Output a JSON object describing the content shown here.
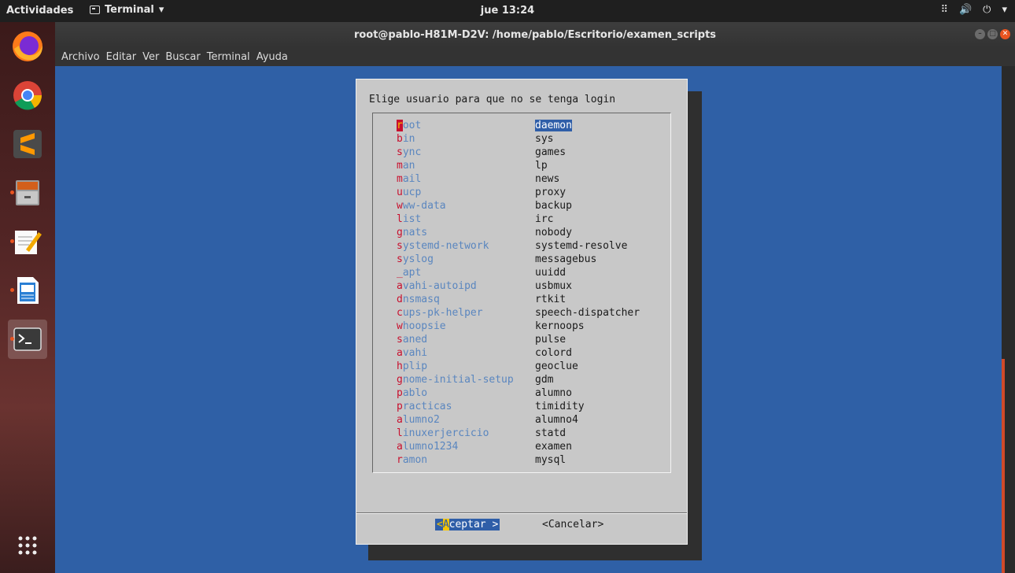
{
  "topbar": {
    "activities": "Actividades",
    "app_menu": "Terminal",
    "clock": "jue 13:24"
  },
  "window": {
    "title": "root@pablo-H81M-D2V: /home/pablo/Escritorio/examen_scripts",
    "menu": [
      "Archivo",
      "Editar",
      "Ver",
      "Buscar",
      "Terminal",
      "Ayuda"
    ]
  },
  "dock": {
    "items": [
      "firefox-icon",
      "chrome-icon",
      "sublime-text-icon",
      "files-icon",
      "text-editor-icon",
      "libreoffice-writer-icon",
      "terminal-icon",
      "show-apps-icon"
    ]
  },
  "dialog": {
    "prompt": "Elige usuario para que no se tenga login",
    "rows": [
      {
        "tag": "root",
        "item": "daemon",
        "selected": true
      },
      {
        "tag": "bin",
        "item": "sys"
      },
      {
        "tag": "sync",
        "item": "games"
      },
      {
        "tag": "man",
        "item": "lp"
      },
      {
        "tag": "mail",
        "item": "news"
      },
      {
        "tag": "uucp",
        "item": "proxy"
      },
      {
        "tag": "www-data",
        "item": "backup"
      },
      {
        "tag": "list",
        "item": "irc"
      },
      {
        "tag": "gnats",
        "item": "nobody"
      },
      {
        "tag": "systemd-network",
        "item": "systemd-resolve"
      },
      {
        "tag": "syslog",
        "item": "messagebus"
      },
      {
        "tag": "_apt",
        "item": "uuidd"
      },
      {
        "tag": "avahi-autoipd",
        "item": "usbmux"
      },
      {
        "tag": "dnsmasq",
        "item": "rtkit"
      },
      {
        "tag": "cups-pk-helper",
        "item": "speech-dispatcher"
      },
      {
        "tag": "whoopsie",
        "item": "kernoops"
      },
      {
        "tag": "saned",
        "item": "pulse"
      },
      {
        "tag": "avahi",
        "item": "colord"
      },
      {
        "tag": "hplip",
        "item": "geoclue"
      },
      {
        "tag": "gnome-initial-setup",
        "item": "gdm"
      },
      {
        "tag": "pablo",
        "item": "alumno"
      },
      {
        "tag": "practicas",
        "item": "timidity"
      },
      {
        "tag": "alumno2",
        "item": "alumno4"
      },
      {
        "tag": "linuxerjercicio",
        "item": "statd"
      },
      {
        "tag": "alumno1234",
        "item": "examen"
      },
      {
        "tag": "ramon",
        "item": "mysql"
      }
    ],
    "ok_button": {
      "open": "<",
      "hotkey": "A",
      "rest": "ceptar >"
    },
    "cancel_button": "<Cancelar>"
  },
  "colors": {
    "screen_bg": "#2f60a6",
    "dialog_bg": "#c8c8c8",
    "tag_first_letter": "#c8102e",
    "tag_rest": "#5a86bf",
    "selection_bg": "#2f5ea8",
    "ubuntu_orange": "#e95420"
  }
}
